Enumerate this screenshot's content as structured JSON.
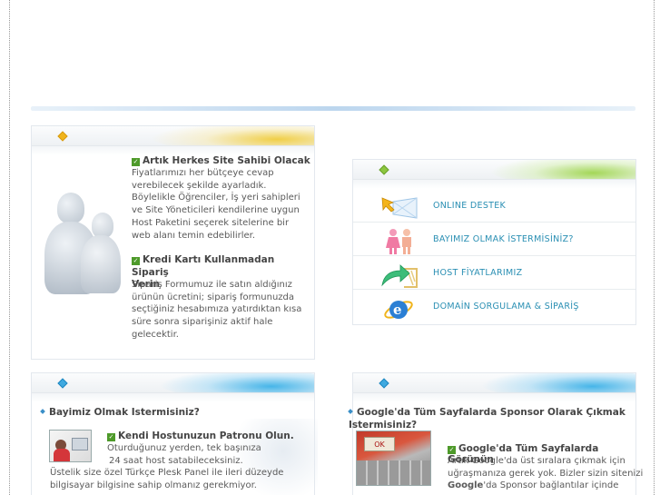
{
  "left_panel": {
    "item1_title": "Artık Herkes Site Sahibi Olacak",
    "item1_lines": [
      "Fiyatlarımızı her bütçeye cevap",
      "verebilecek şekilde ayarladık.",
      "Böylelikle Öğrenciler, İş yeri sahipleri",
      "ve Site Yöneticileri kendilerine uygun",
      "Host Paketini seçerek sitelerine bir",
      "web alanı temin edebilirler."
    ],
    "item2_title_line1": "Kredi Kartı Kullanmadan Sipariş",
    "item2_title_line2": "Verin",
    "item2_lines": [
      "Sipariş Formumuz ile satın aldığınız",
      "ürünün ücretini; sipariş formunuzda",
      "seçtiğiniz hesabımıza yatırdıktan kısa",
      "süre sonra siparişiniz aktif hale",
      "gelecektir."
    ]
  },
  "menu": {
    "items": [
      {
        "label": "ONLINE DESTEK",
        "icon": "arrow-cursor-icon"
      },
      {
        "label": "BAYIMIZ OLMAK İSTERMİSİNİZ?",
        "icon": "people-icon"
      },
      {
        "label": "HOST FİYATLARIMIZ",
        "icon": "green-arrow-icon"
      },
      {
        "label": "DOMAİN SORGULAMA & SİPARİŞ",
        "icon": "internet-explorer-icon"
      }
    ]
  },
  "bottom_left": {
    "title": "Bayimiz Olmak Istermisiniz?",
    "subtitle": "Kendi Hostunuzun Patronu Olun.",
    "lines_indented": [
      "Oturduğunuz yerden, tek başınıza",
      "24 saat host satabileceksiniz."
    ],
    "lines": [
      "Üstelik size özel Türkçe Plesk Panel ile ileri düzeyde",
      "bilgisayar bilgisine sahip olmanız gerekmiyor."
    ]
  },
  "bottom_right": {
    "title_line1": "Google'da Tüm Sayfalarda Sponsor Olarak Çıkmak",
    "title_line2": "Istermisiniz?",
    "subtitle": "Google'da Tüm Sayfalarda Görünün",
    "line1": "Artık Google'da üst sıralara çıkmak için",
    "line2": "uğraşmanıza gerek yok. Bizler sizin sitenizi",
    "line3_bold": "Google",
    "line3_rest": "'da Sponsor bağlantılar içinde",
    "photo_text": "OK"
  },
  "colors": {
    "menu_text": "#2a8fb3",
    "title_text": "#454545",
    "check_green": "#4e9a2a"
  }
}
